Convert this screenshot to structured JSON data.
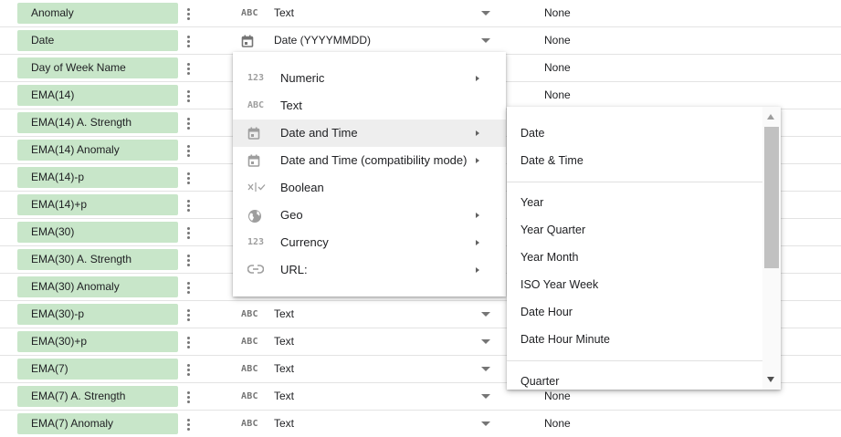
{
  "fields": [
    {
      "name": "Anomaly",
      "type_icon": "abc-icon",
      "type": "Text",
      "aggregation": "None"
    },
    {
      "name": "Date",
      "type_icon": "calendar-icon",
      "type": "Date (YYYYMMDD)",
      "aggregation": "None"
    },
    {
      "name": "Day of Week Name",
      "type_icon": "",
      "type": "",
      "aggregation": "None"
    },
    {
      "name": "EMA(14)",
      "type_icon": "",
      "type": "",
      "aggregation": "None"
    },
    {
      "name": "EMA(14) A. Strength",
      "type_icon": "",
      "type": "",
      "aggregation": ""
    },
    {
      "name": "EMA(14) Anomaly",
      "type_icon": "",
      "type": "",
      "aggregation": ""
    },
    {
      "name": "EMA(14)-p",
      "type_icon": "",
      "type": "",
      "aggregation": ""
    },
    {
      "name": "EMA(14)+p",
      "type_icon": "",
      "type": "",
      "aggregation": ""
    },
    {
      "name": "EMA(30)",
      "type_icon": "",
      "type": "",
      "aggregation": ""
    },
    {
      "name": "EMA(30) A. Strength",
      "type_icon": "",
      "type": "",
      "aggregation": ""
    },
    {
      "name": "EMA(30) Anomaly",
      "type_icon": "",
      "type": "",
      "aggregation": ""
    },
    {
      "name": "EMA(30)-p",
      "type_icon": "abc-icon",
      "type": "Text",
      "aggregation": ""
    },
    {
      "name": "EMA(30)+p",
      "type_icon": "abc-icon",
      "type": "Text",
      "aggregation": ""
    },
    {
      "name": "EMA(7)",
      "type_icon": "abc-icon",
      "type": "Text",
      "aggregation": ""
    },
    {
      "name": "EMA(7) A. Strength",
      "type_icon": "abc-icon",
      "type": "Text",
      "aggregation": "None"
    },
    {
      "name": "EMA(7) Anomaly",
      "type_icon": "abc-icon",
      "type": "Text",
      "aggregation": "None"
    }
  ],
  "type_menu": {
    "items": [
      {
        "icon": "numeric-icon",
        "icon_text": "123",
        "label": "Numeric",
        "has_submenu": true
      },
      {
        "icon": "text-icon",
        "icon_text": "ABC",
        "label": "Text",
        "has_submenu": false
      },
      {
        "icon": "calendar-icon",
        "icon_text": "",
        "label": "Date and Time",
        "has_submenu": true,
        "active": true
      },
      {
        "icon": "calendar-icon",
        "icon_text": "",
        "label": "Date and Time (compatibility mode)",
        "has_submenu": true
      },
      {
        "icon": "boolean-icon",
        "icon_text": "",
        "label": "Boolean",
        "has_submenu": false
      },
      {
        "icon": "globe-icon",
        "icon_text": "",
        "label": "Geo",
        "has_submenu": true
      },
      {
        "icon": "currency-icon",
        "icon_text": "123",
        "label": "Currency",
        "has_submenu": true
      },
      {
        "icon": "link-icon",
        "icon_text": "",
        "label": "URL:",
        "has_submenu": true
      }
    ]
  },
  "date_submenu": {
    "groups": [
      [
        "Date",
        "Date & Time"
      ],
      [
        "Year",
        "Year Quarter",
        "Year Month",
        "ISO Year Week",
        "Date Hour",
        "Date Hour Minute"
      ],
      [
        "Quarter"
      ]
    ]
  },
  "type_icon_text": {
    "abc-icon": "ABC"
  },
  "colors": {
    "chip": "#c8e6c9",
    "menu_active": "#eeeeee"
  }
}
